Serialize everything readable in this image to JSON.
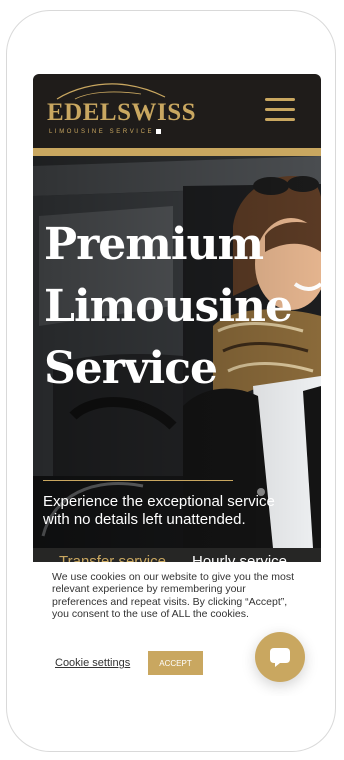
{
  "header": {
    "logo_main": "EDELSWISS",
    "logo_sub": "LIMOUSINE SERVICE",
    "menu_icon": "hamburger-icon"
  },
  "hero": {
    "title_lines": [
      "Premium",
      "Limousine",
      "Service"
    ],
    "description": "Experience the exceptional service with no details left unattended."
  },
  "tabs": [
    {
      "label": "Transfer service",
      "active": true
    },
    {
      "label": "Hourly service",
      "active": false
    }
  ],
  "cookie": {
    "text": "We use cookies on our website to give you the most relevant experience by remembering your preferences and repeat visits. By clicking “Accept”, you consent to the use of ALL the cookies.",
    "settings_label": "Cookie settings",
    "accept_label": "ACCEPT"
  },
  "chat": {
    "icon": "chat-bubble-icon"
  },
  "colors": {
    "accent_gold": "#c9a760",
    "header_bg": "#1f1c1a",
    "tabs_bg": "#262625"
  }
}
